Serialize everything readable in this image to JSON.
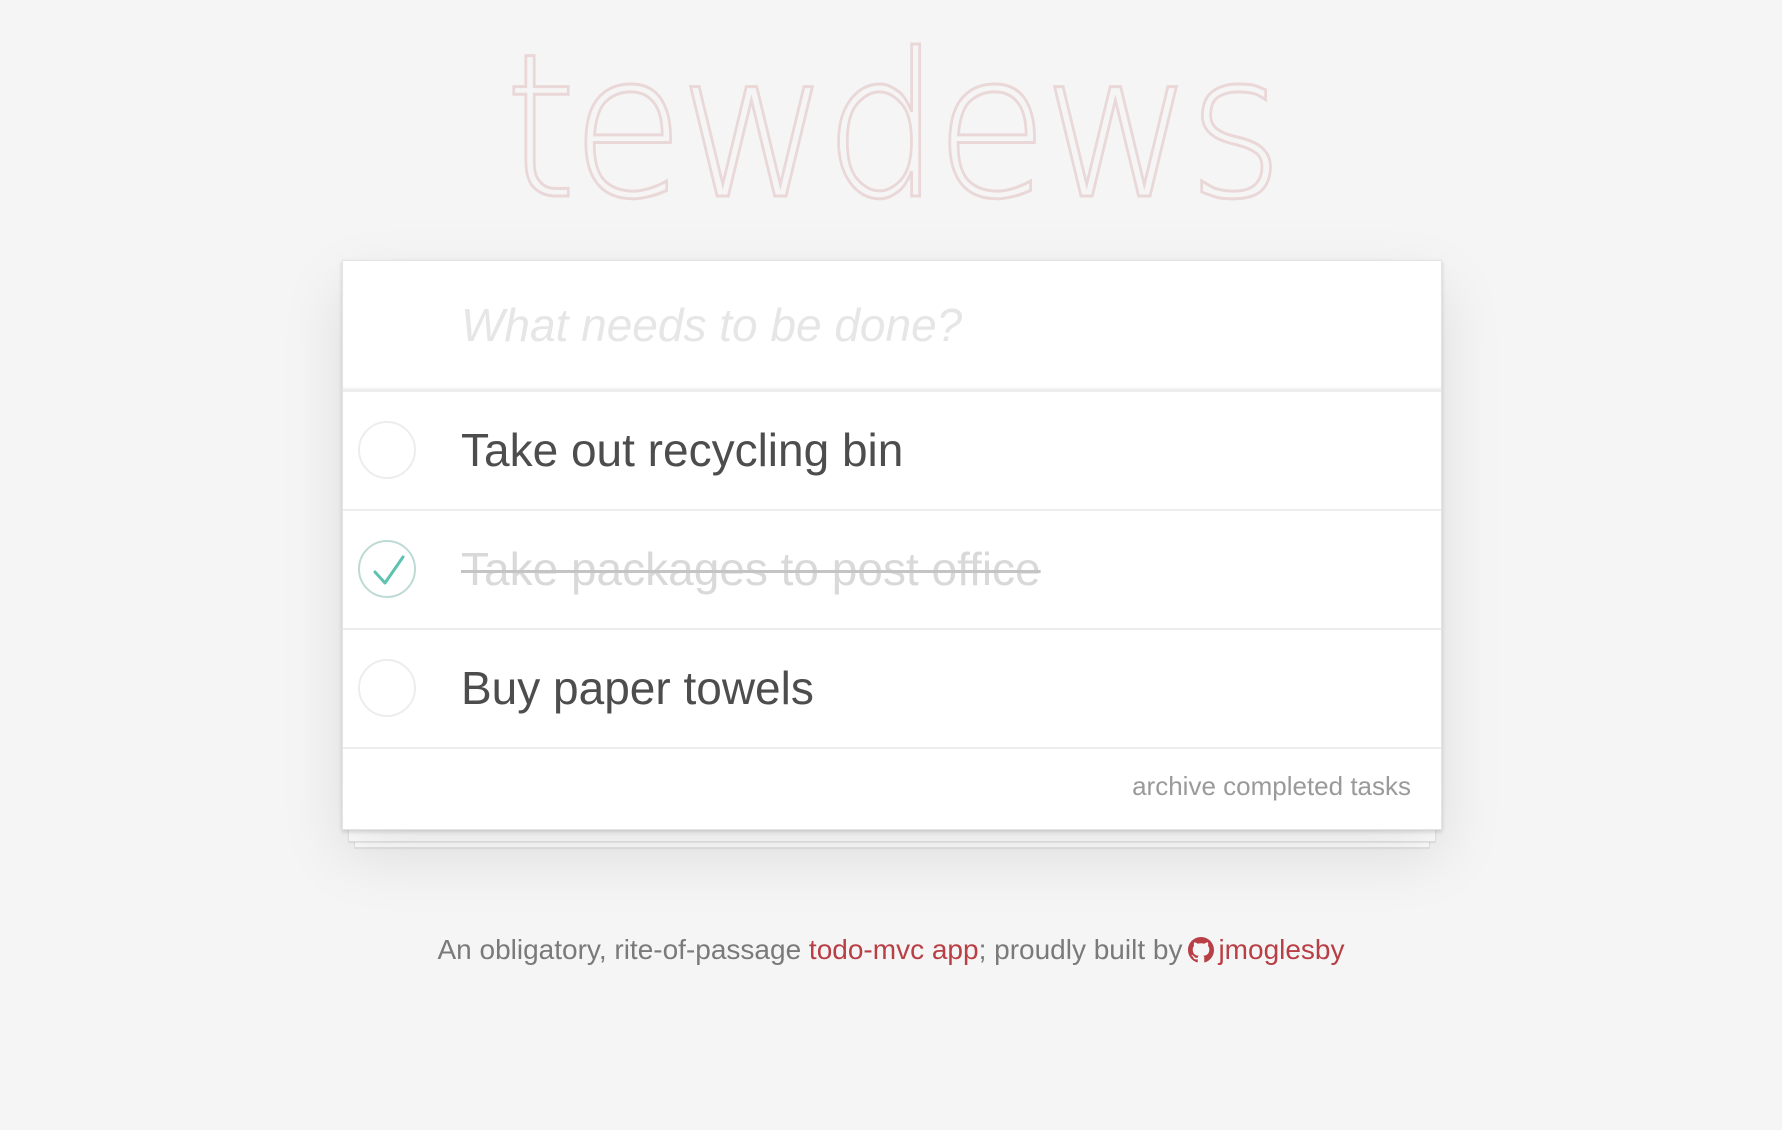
{
  "app": {
    "title": "tewdews"
  },
  "new_todo": {
    "placeholder": "What needs to be done?",
    "value": ""
  },
  "todos": [
    {
      "label": "Take out recycling bin",
      "completed": false
    },
    {
      "label": "Take packages to post office",
      "completed": true
    },
    {
      "label": "Buy paper towels",
      "completed": false
    }
  ],
  "footer_bar": {
    "archive_label": "archive completed tasks"
  },
  "page_footer": {
    "prefix": "An obligatory, rite-of-passage ",
    "link1_text": "todo-mvc app",
    "middle": "; proudly built by",
    "icon": "github-icon",
    "link2_text": "jmoglesby"
  },
  "colors": {
    "title": "#ead7d7",
    "check": "#5dc2af",
    "link": "#b83f45",
    "background": "#f5f5f5"
  }
}
